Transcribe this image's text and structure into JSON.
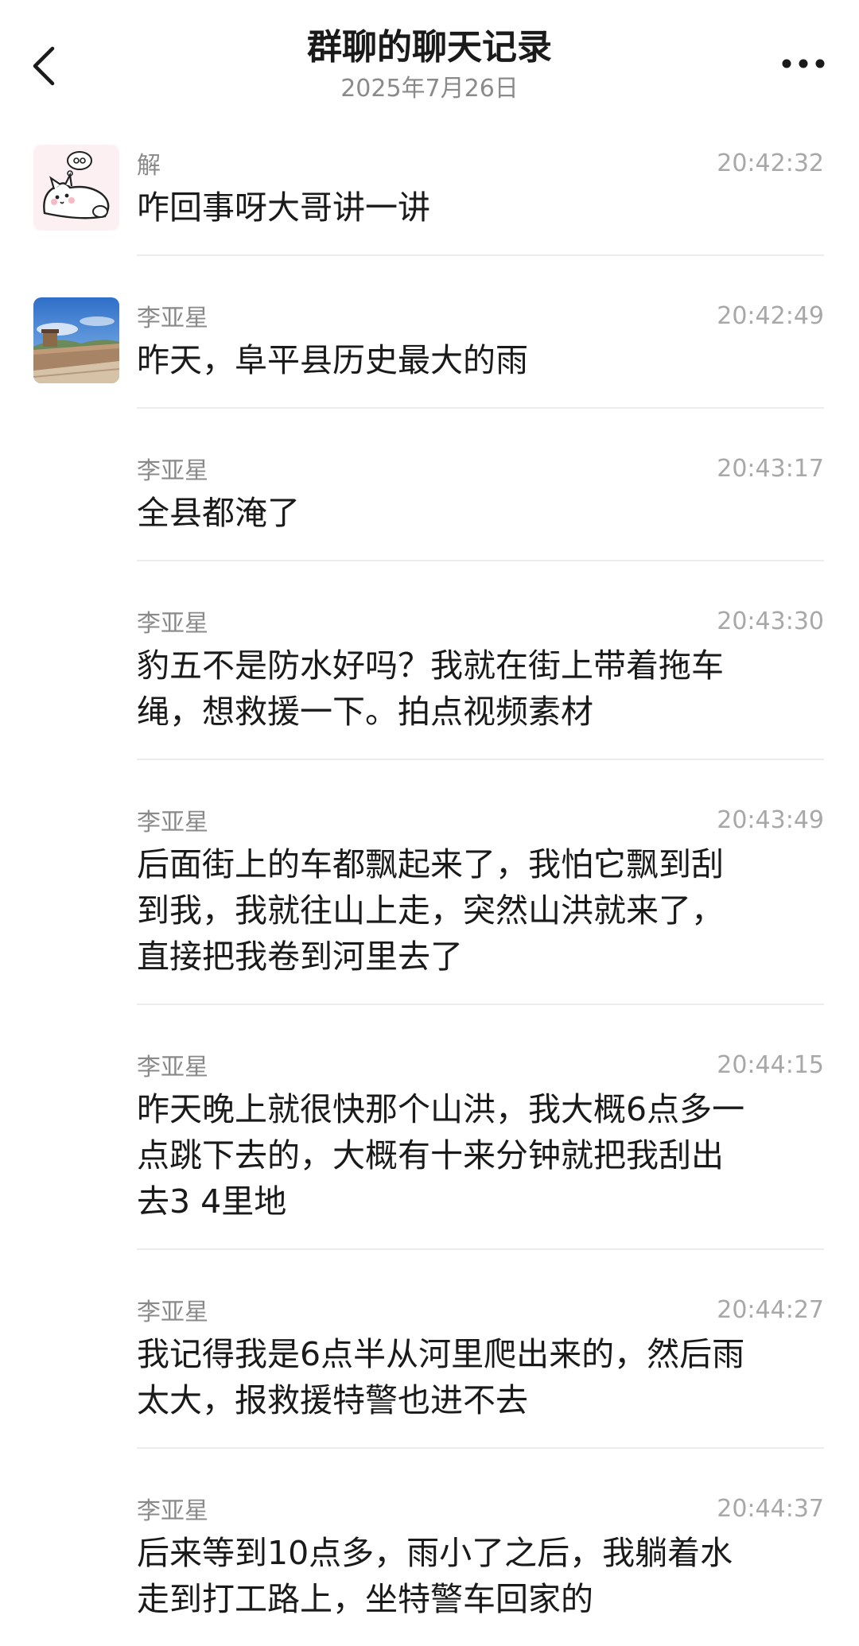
{
  "header": {
    "title": "群聊的聊天记录",
    "date": "2025年7月26日",
    "back_icon": "chevron-left-icon",
    "more_icon": "more-horizontal-icon"
  },
  "messages": [
    {
      "sender": "解",
      "time": "20:42:32",
      "text": "咋回事呀大哥讲一讲",
      "avatar": "cartoon-cat-avatar"
    },
    {
      "sender": "李亚星",
      "time": "20:42:49",
      "text": "昨天，阜平县历史最大的雨",
      "avatar": "great-wall-photo-avatar"
    },
    {
      "sender": "李亚星",
      "time": "20:43:17",
      "text": "全县都淹了"
    },
    {
      "sender": "李亚星",
      "time": "20:43:30",
      "text": "豹五不是防水好吗？我就在街上带着拖车\n绳，想救援一下。拍点视频素材"
    },
    {
      "sender": "李亚星",
      "time": "20:43:49",
      "text": "后面街上的车都飘起来了，我怕它飘到刮\n到我，我就往山上走，突然山洪就来了，\n直接把我卷到河里去了"
    },
    {
      "sender": "李亚星",
      "time": "20:44:15",
      "text": "昨天晚上就很快那个山洪，我大概6点多一\n点跳下去的，大概有十来分钟就把我刮出\n去3 4里地"
    },
    {
      "sender": "李亚星",
      "time": "20:44:27",
      "text": "我记得我是6点半从河里爬出来的，然后雨\n太大，报救援特警也进不去"
    },
    {
      "sender": "李亚星",
      "time": "20:44:37",
      "text": "后来等到10点多，雨小了之后，我躺着水\n走到打工路上，坐特警车回家的"
    }
  ]
}
